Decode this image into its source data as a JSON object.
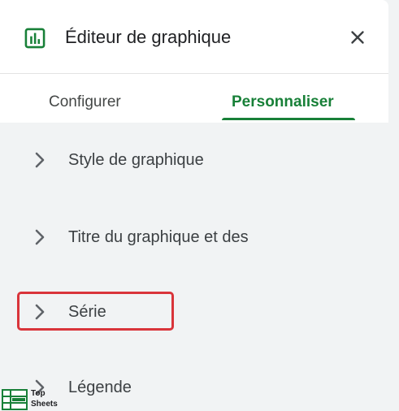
{
  "header": {
    "title": "Éditeur de graphique",
    "icon": "chart-icon",
    "close_icon": "close-icon"
  },
  "tabs": [
    {
      "label": "Configurer",
      "active": false
    },
    {
      "label": "Personnaliser",
      "active": true
    }
  ],
  "sections": [
    {
      "label": "Style de graphique",
      "icon": "chevron-right-icon"
    },
    {
      "label": "Titre du graphique et des",
      "icon": "chevron-right-icon"
    },
    {
      "label": "Série",
      "icon": "chevron-right-icon",
      "highlighted": true
    },
    {
      "label": "Légende",
      "icon": "chevron-right-icon"
    }
  ],
  "watermark": {
    "line1": "Top",
    "line2": "Sheets"
  },
  "colors": {
    "accent": "#188038",
    "highlight": "#d9343a",
    "panel_bg": "#f1f3f4"
  }
}
